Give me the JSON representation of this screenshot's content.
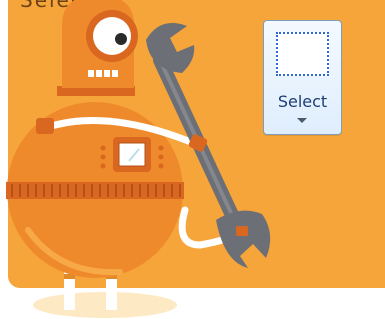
{
  "top_caption": "Select It",
  "ribbon": {
    "select_button": {
      "label": "Select",
      "icon": "dotted-selection-rectangle",
      "menu_icon": "chevron-down"
    }
  },
  "illustration": {
    "subject": "robot-holding-wrench",
    "colors": {
      "panel": "#f6a53a",
      "robot": "#ef8a2c",
      "wrench": "#6c6f75"
    }
  }
}
